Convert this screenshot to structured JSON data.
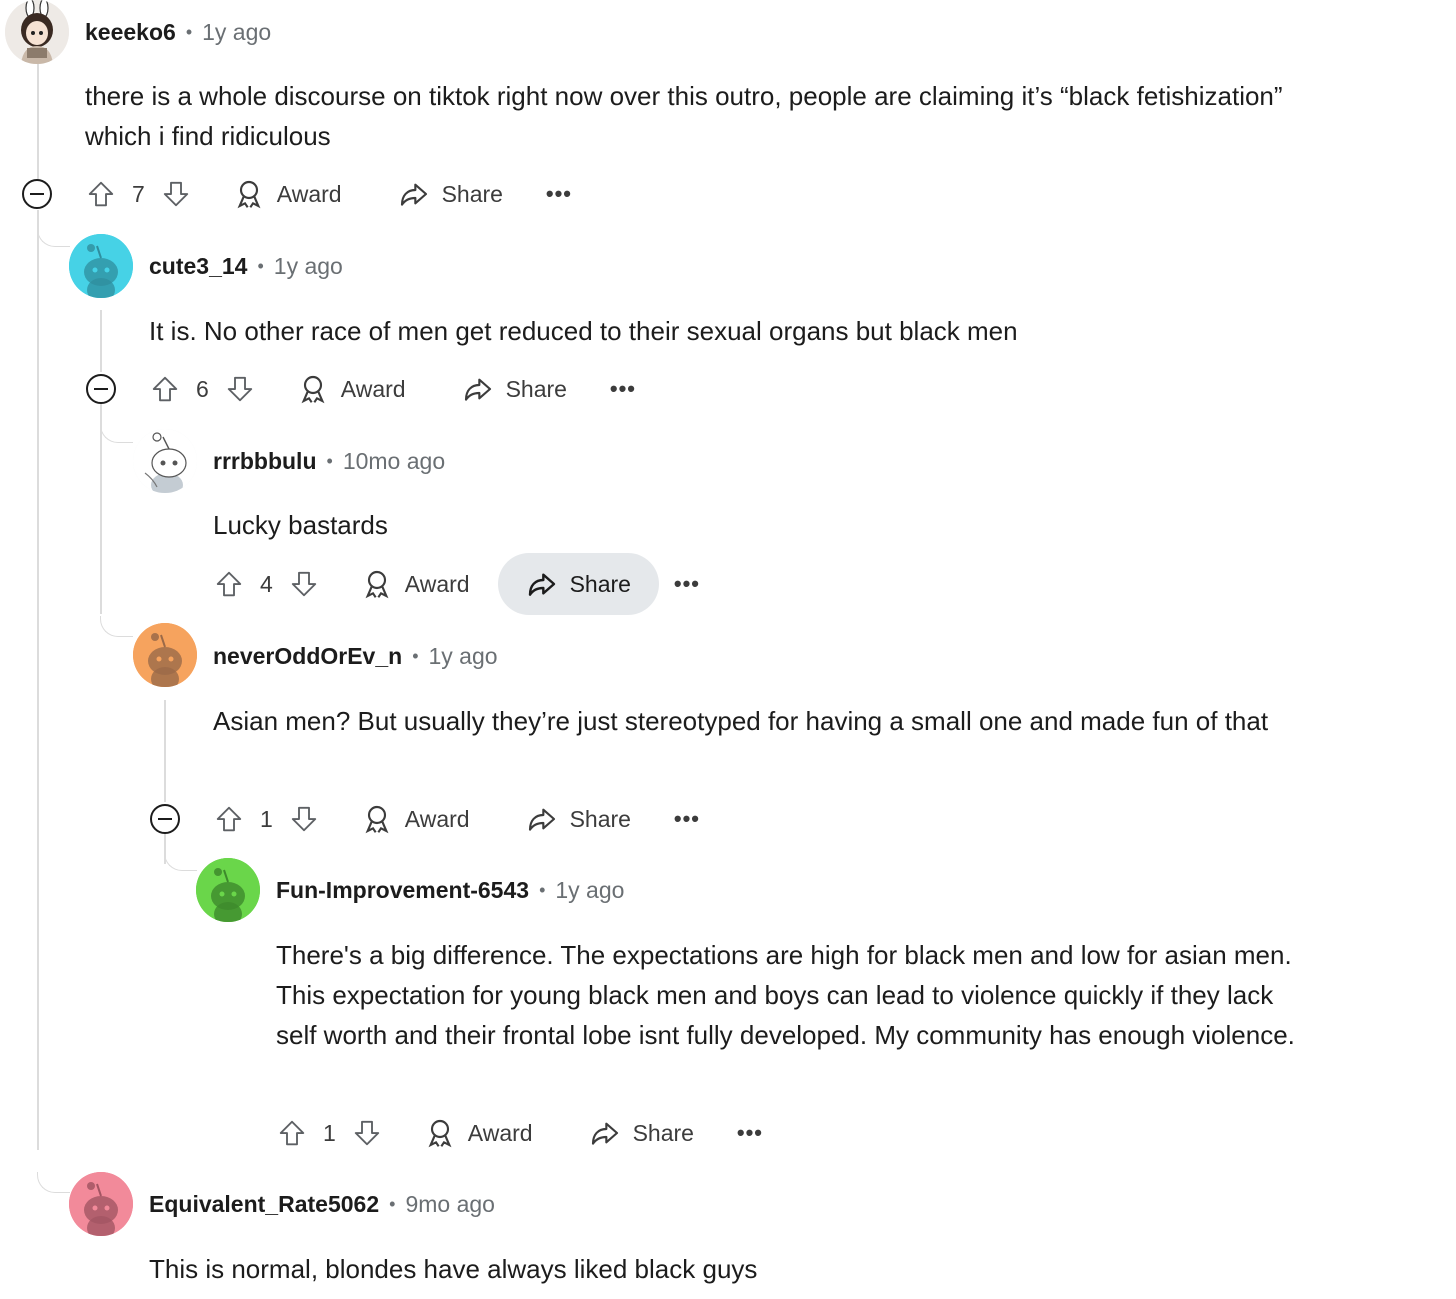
{
  "comments": [
    {
      "username": "keeeko6",
      "time": "1y ago",
      "body": "there is a whole discourse on tiktok right now over this outro, people are claiming it’s “black fetishization” which i find ridiculous",
      "votes": "7",
      "avatar_icon": "anime-girl-avatar-icon"
    },
    {
      "username": "cute3_14",
      "time": "1y ago",
      "body": "It is. No other race of men get reduced to their sexual organs but black men",
      "votes": "6",
      "avatar_color": "#46d2e6",
      "avatar_icon": "snoo-avatar-icon"
    },
    {
      "username": "rrrbbbulu",
      "time": "10mo ago",
      "body": "Lucky bastards",
      "votes": "4",
      "avatar_icon": "snoo-ghost-avatar-icon"
    },
    {
      "username": "neverOddOrEv_n",
      "time": "1y ago",
      "body": "Asian men? But usually they’re just stereotyped for having a small one and made fun of that",
      "votes": "1",
      "avatar_color": "#f6a35e",
      "avatar_icon": "snoo-avatar-icon"
    },
    {
      "username": "Fun-Improvement-6543",
      "time": "1y ago",
      "body": "There's a big difference. The expectations are high for black men and low for asian men. This expectation for young black men and boys can lead to violence quickly if they lack self worth and their frontal lobe isnt fully developed. My community has enough violence.",
      "votes": "1",
      "avatar_color": "#6ad64a",
      "avatar_icon": "snoo-avatar-icon"
    },
    {
      "username": "Equivalent_Rate5062",
      "time": "9mo ago",
      "body": "This is normal, blondes have always liked black guys",
      "avatar_color": "#f28a9a",
      "avatar_icon": "snoo-avatar-icon"
    }
  ],
  "labels": {
    "award": "Award",
    "share": "Share",
    "more": "•••",
    "separator": "•"
  }
}
